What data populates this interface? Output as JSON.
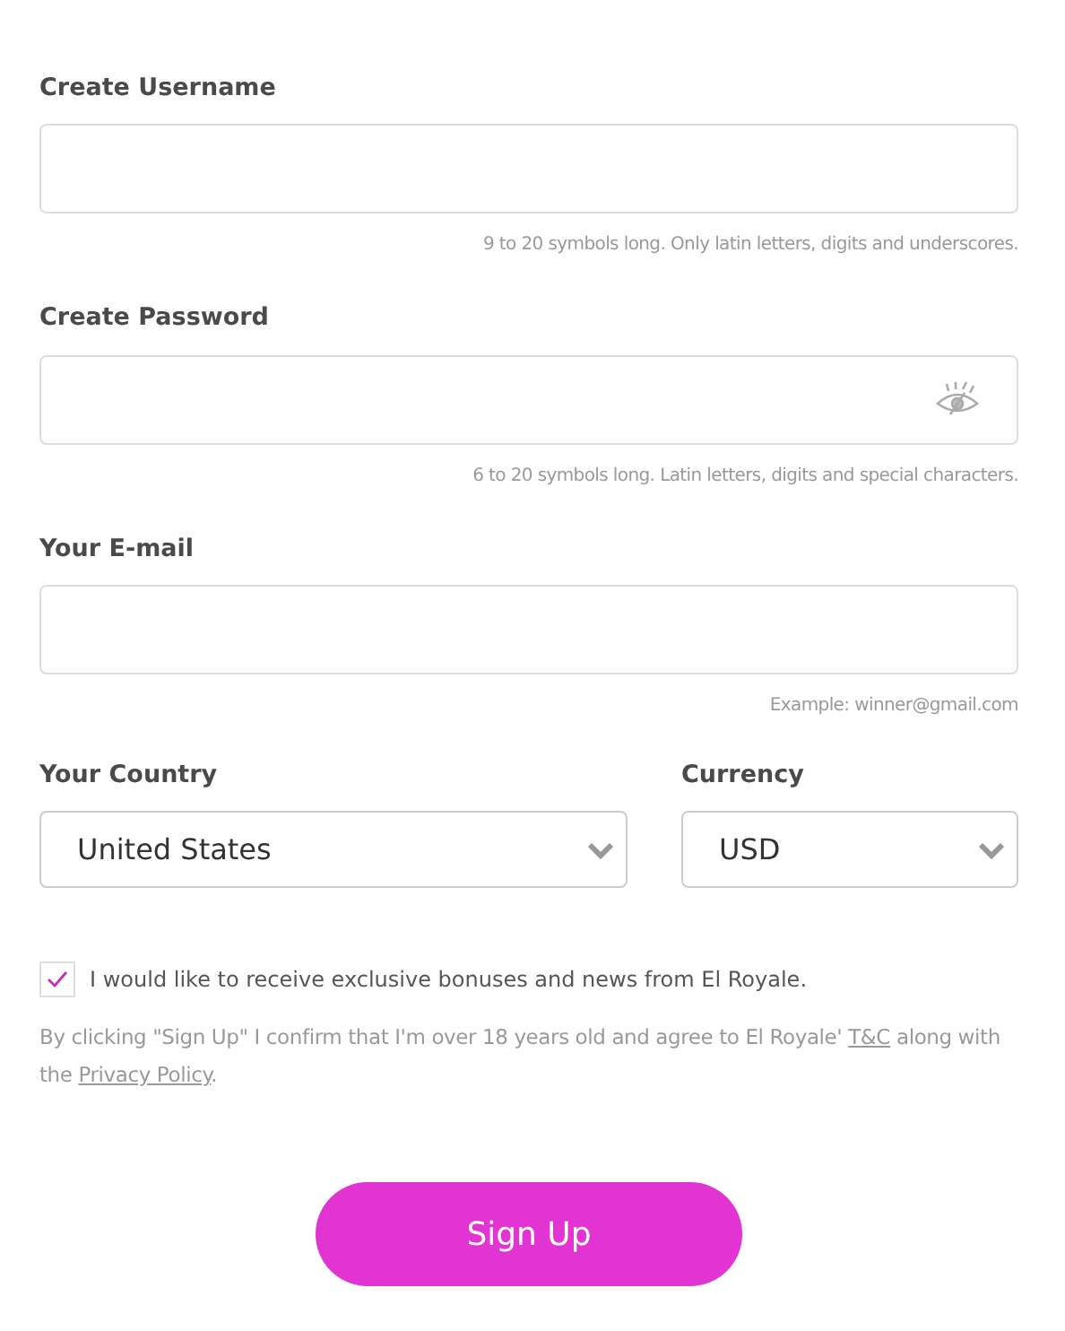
{
  "fields": [
    {
      "kind": "text",
      "label": "Create Username",
      "hint": "9 to 20 symbols long. Only latin letters, digits and underscores."
    },
    {
      "kind": "password",
      "label": "Create Password",
      "hint": "6 to 20 symbols long. Latin letters, digits and special characters."
    },
    {
      "kind": "email",
      "label": "Your E-mail",
      "hint": "Example: winner@gmail.com"
    }
  ],
  "selects": [
    {
      "label": "Your Country",
      "value": "United States"
    },
    {
      "label": "Currency",
      "value": "USD"
    }
  ],
  "newsletter": {
    "label": "I would like to receive exclusive bonuses and news from El Royale.",
    "checked": true
  },
  "terms": [
    {
      "kind": "text",
      "text": "By clicking \"Sign Up\" I confirm that I'm over 18 years old and agree to El Royale' "
    },
    {
      "kind": "link",
      "text": "T&C"
    },
    {
      "kind": "text",
      "text": " along with the "
    },
    {
      "kind": "link",
      "text": "Privacy Policy"
    },
    {
      "kind": "text",
      "text": "."
    }
  ],
  "submit": "Sign Up"
}
